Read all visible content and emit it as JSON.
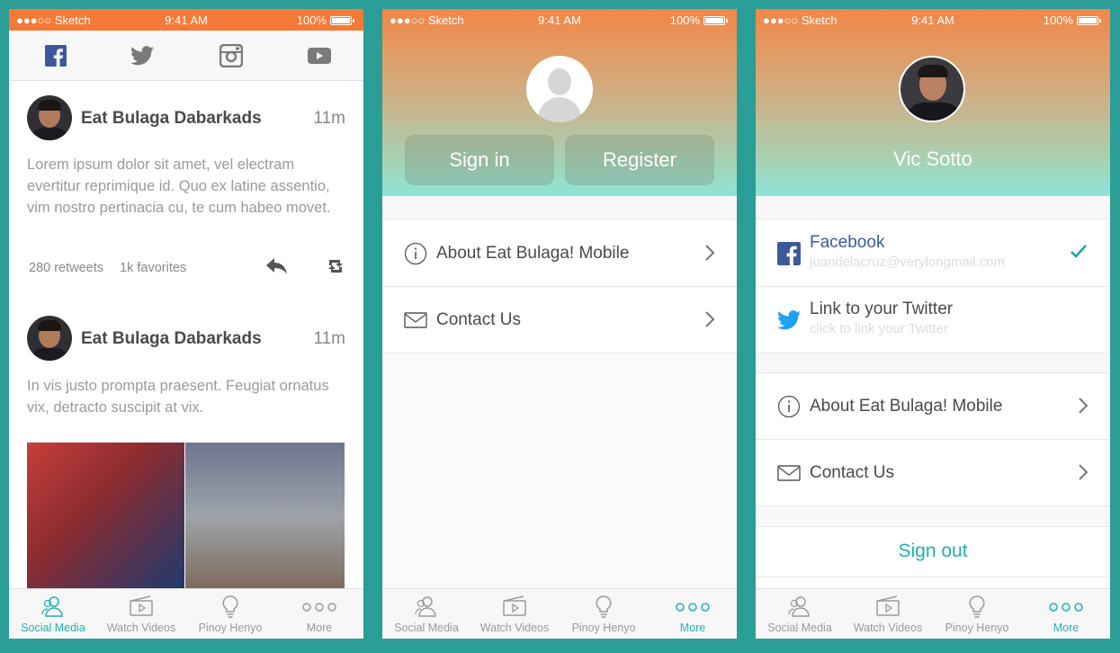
{
  "colors": {
    "background": "#2a9e96",
    "orange_status": "#f57a37",
    "accent": "#1fb1b7",
    "facebook": "#3b5998",
    "twitter": "#1da1f2"
  },
  "status_bar": {
    "carrier": "●●●○○ Sketch",
    "time": "9:41 AM",
    "battery": "100%"
  },
  "tab_bar": {
    "items": [
      {
        "label": "Social Media",
        "icon": "people-icon"
      },
      {
        "label": "Watch Videos",
        "icon": "video-icon"
      },
      {
        "label": "Pinoy Henyo",
        "icon": "lightbulb-icon"
      },
      {
        "label": "More",
        "icon": "more-icon"
      }
    ]
  },
  "feed": {
    "social_tabs": [
      "facebook-icon",
      "twitter-icon",
      "instagram-icon",
      "youtube-icon"
    ],
    "posts": [
      {
        "author": "Eat Bulaga Dabarkads",
        "time": "11m",
        "body": "Lorem ipsum dolor sit amet, vel electram evertitur reprimique id. Quo ex latine assentio, vim nostro pertinacia cu, te cum habeo movet.",
        "retweets": "280 retweets",
        "favorites": "1k favorites"
      },
      {
        "author": "Eat Bulaga Dabarkads",
        "time": "11m",
        "body": "In vis justo prompta praesent. Feugiat ornatus vix, detracto suscipit at vix."
      }
    ]
  },
  "guest": {
    "sign_in": "Sign in",
    "register": "Register",
    "menu": [
      {
        "label": "About Eat Bulaga! Mobile",
        "icon": "info-icon"
      },
      {
        "label": "Contact Us",
        "icon": "mail-icon"
      }
    ]
  },
  "profile": {
    "name": "Vic Sotto",
    "accounts": [
      {
        "title": "Facebook",
        "subtitle": "juandelacruz@verylongmail.com",
        "linked": true
      },
      {
        "title": "Link to your Twitter",
        "subtitle": "click to link your Twitter",
        "linked": false
      }
    ],
    "menu": [
      {
        "label": "About Eat Bulaga! Mobile"
      },
      {
        "label": "Contact Us"
      }
    ],
    "sign_out": "Sign out"
  }
}
